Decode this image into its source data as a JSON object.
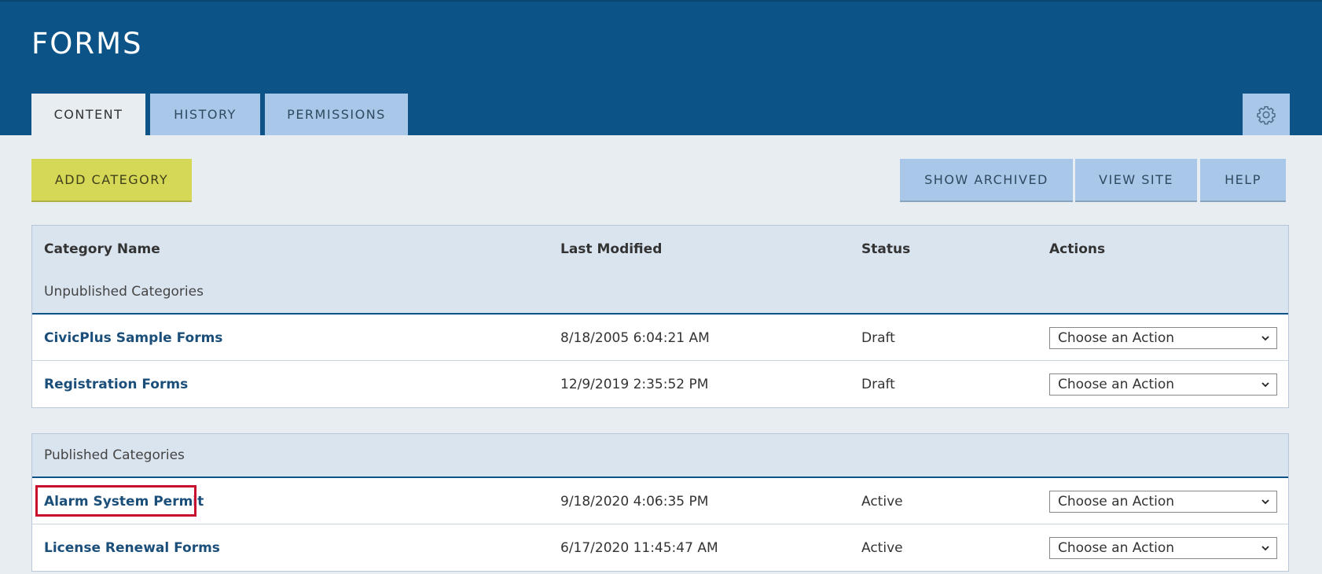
{
  "header": {
    "title": "FORMS",
    "tabs": [
      {
        "label": "CONTENT",
        "active": true
      },
      {
        "label": "HISTORY",
        "active": false
      },
      {
        "label": "PERMISSIONS",
        "active": false
      }
    ],
    "settings_icon": "gear-icon"
  },
  "toolbar": {
    "add_category": "ADD CATEGORY",
    "show_archived": "SHOW ARCHIVED",
    "view_site": "VIEW SITE",
    "help": "HELP"
  },
  "table": {
    "columns": [
      "Category Name",
      "Last Modified",
      "Status",
      "Actions"
    ],
    "unpublished": {
      "label": "Unpublished Categories",
      "rows": [
        {
          "name": "CivicPlus Sample Forms",
          "modified": "8/18/2005 6:04:21 AM",
          "status": "Draft",
          "action": "Choose an Action"
        },
        {
          "name": "Registration Forms",
          "modified": "12/9/2019 2:35:52 PM",
          "status": "Draft",
          "action": "Choose an Action"
        }
      ]
    },
    "published": {
      "label": "Published Categories",
      "rows": [
        {
          "name": "Alarm System Permit",
          "modified": "9/18/2020 4:06:35 PM",
          "status": "Active",
          "action": "Choose an Action",
          "highlighted": true
        },
        {
          "name": "License Renewal Forms",
          "modified": "6/17/2020 11:45:47 AM",
          "status": "Active",
          "action": "Choose an Action"
        }
      ]
    }
  },
  "colors": {
    "header_bg": "#0c5488",
    "tab_bg": "#a9c7e8",
    "add_button_bg": "#d5d856",
    "link": "#1b4f7a",
    "highlight": "#c8102e"
  }
}
